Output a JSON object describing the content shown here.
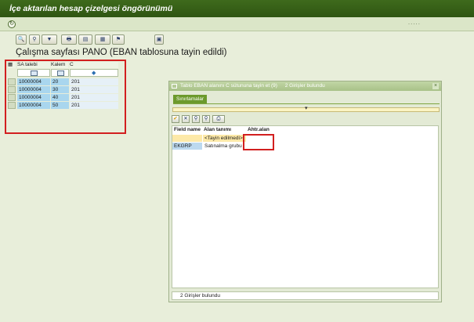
{
  "window": {
    "title": "İçe aktarılan hesap çizelgesi öngörünümü"
  },
  "appbar": {
    "dots": "....."
  },
  "toolbar": {
    "buttons": [
      {
        "glyph": "🔍"
      },
      {
        "glyph": "⚲"
      },
      {
        "glyph": "▼"
      },
      {
        "glyph": "🖶"
      },
      {
        "glyph": "▤"
      },
      {
        "glyph": "▦"
      },
      {
        "glyph": "⚑"
      },
      {
        "glyph": "▣"
      }
    ]
  },
  "report": {
    "title": "Çalışma sayfası PANO (EBAN tablosuna tayin edildi)"
  },
  "main_grid": {
    "headers": [
      "SA talebi",
      "Kalem",
      "C"
    ],
    "rows": [
      {
        "sa": "10000004",
        "kalem": "20",
        "c": "201"
      },
      {
        "sa": "10000004",
        "kalem": "30",
        "c": "201"
      },
      {
        "sa": "10000004",
        "kalem": "40",
        "c": "201"
      },
      {
        "sa": "10000004",
        "kalem": "50",
        "c": "201"
      }
    ]
  },
  "popup": {
    "title": "Tablo EBAN alanını C sütununa tayin et (9)",
    "title_count": "2 Girişler bulundu",
    "close": "×",
    "tab": "Sınırlamalar",
    "headers": [
      "Field name",
      "Alan tanımı",
      "Ahtr.alan"
    ],
    "rows": [
      {
        "field": "",
        "desc": "<Tayin edilmedi>",
        "alt": ""
      },
      {
        "field": "EKGRP",
        "desc": "Satınalma grubu",
        "alt": ""
      }
    ],
    "status": "2 Girişler bulundu"
  }
}
